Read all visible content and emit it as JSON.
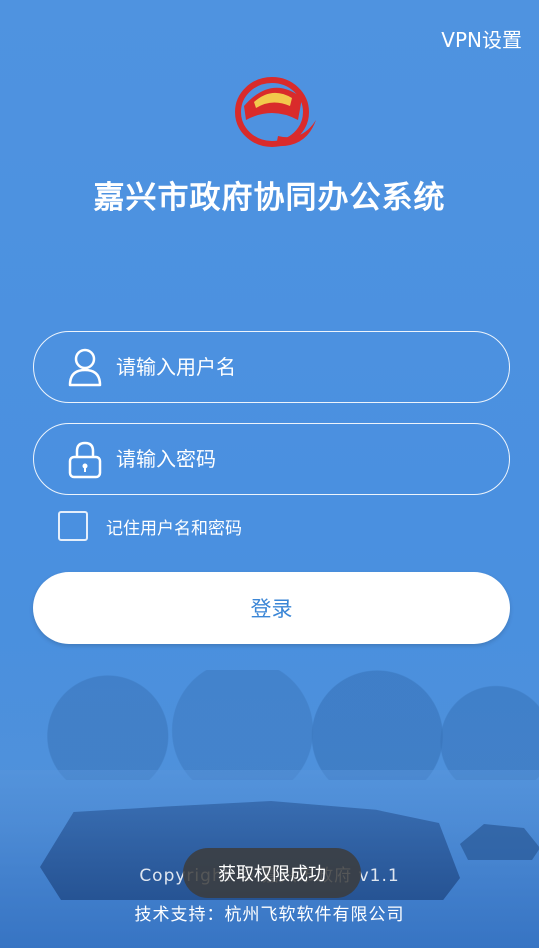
{
  "header": {
    "vpn_link": "VPN设置",
    "app_title": "嘉兴市政府协同办公系统",
    "logo_icon": "party-emblem-logo"
  },
  "login_form": {
    "username_placeholder": "请输入用户名",
    "username_icon": "user-icon",
    "password_placeholder": "请输入密码",
    "password_icon": "lock-icon",
    "remember_label": "记住用户名和密码",
    "remember_checked": false,
    "submit_label": "登录"
  },
  "footer": {
    "copyright": "Copyright © 嘉兴市政府 v1.1",
    "support": "技术支持：杭州飞软软件有限公司"
  },
  "toast": {
    "message": "获取权限成功"
  },
  "colors": {
    "background": "#4a90e0",
    "button_text": "#3b86d6",
    "logo_red": "#d92b2b",
    "logo_gold": "#f2c94c"
  }
}
